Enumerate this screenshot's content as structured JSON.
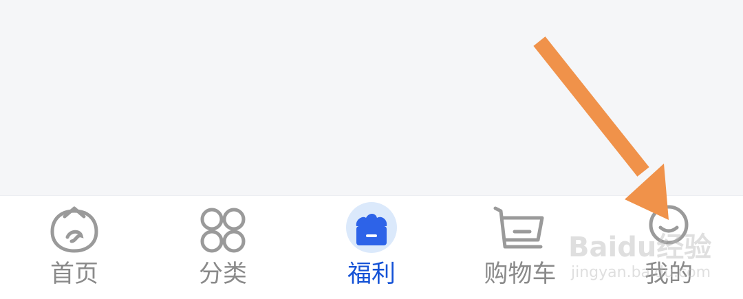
{
  "tabbar": {
    "tabs": [
      {
        "label": "首页",
        "icon": "home-icon",
        "active": false
      },
      {
        "label": "分类",
        "icon": "category-grid-icon",
        "active": false
      },
      {
        "label": "福利",
        "icon": "welfare-gift-box-icon",
        "active": true
      },
      {
        "label": "购物车",
        "icon": "cart-icon",
        "active": false
      },
      {
        "label": "我的",
        "icon": "profile-smile-icon",
        "active": false
      }
    ]
  },
  "colors": {
    "active": "#1452d6",
    "inactive": "#8a8a8a",
    "icon_stroke": "#9a9a9a",
    "annotation_arrow": "#f0924a",
    "background": "#f5f6f8"
  },
  "watermark": {
    "logo": "Baidu经验",
    "url": "jingyan.baidu.com"
  }
}
